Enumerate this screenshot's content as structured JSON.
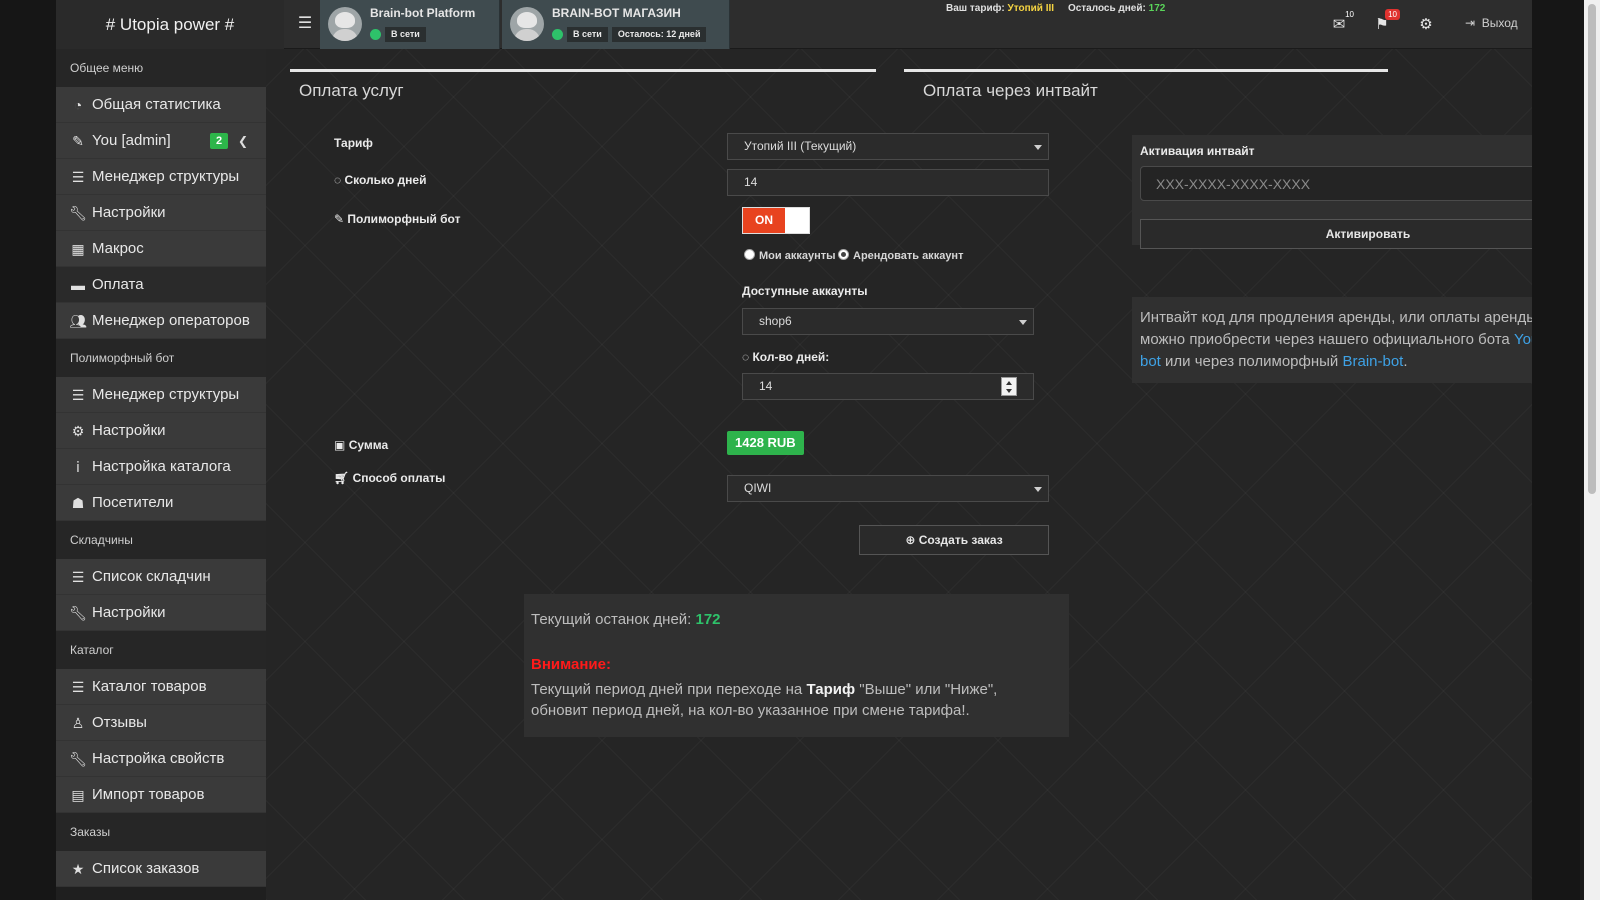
{
  "header": {
    "brand": "# Utopia power #",
    "bots": [
      {
        "name": "Brain-bot Platform",
        "status": "В сети",
        "extra": ""
      },
      {
        "name": "BRAIN-BOT МАГАЗИН",
        "status": "В сети",
        "extra": "Осталось: 12 дней"
      }
    ],
    "tariff_label": "Ваш тариф:",
    "tariff_value": "Утопий III",
    "days_label": "Осталось дней:",
    "days_value": "172",
    "mail_count": "10",
    "flag_count": "10",
    "logout": "Выход"
  },
  "sidebar": {
    "sections": [
      {
        "title": "Общее меню",
        "items": [
          {
            "label": "Общая статистика",
            "icon": "pie-chart-icon"
          },
          {
            "label": "You [admin]",
            "icon": "edit-icon",
            "badge": "2"
          },
          {
            "label": "Менеджер структуры",
            "icon": "list-icon"
          },
          {
            "label": "Настройки",
            "icon": "wrench-icon"
          },
          {
            "label": "Макрос",
            "icon": "grid-icon"
          },
          {
            "label": "Оплата",
            "icon": "credit-card-icon"
          },
          {
            "label": "Менеджер операторов",
            "icon": "users-icon"
          }
        ]
      },
      {
        "title": "Полиморфный бот",
        "items": [
          {
            "label": "Менеджер структуры",
            "icon": "list-icon"
          },
          {
            "label": "Настройки",
            "icon": "gears-icon"
          },
          {
            "label": "Настройка каталога",
            "icon": "info-icon"
          },
          {
            "label": "Посетители",
            "icon": "user-icon"
          }
        ]
      },
      {
        "title": "Складчины",
        "items": [
          {
            "label": "Список складчин",
            "icon": "list-icon"
          },
          {
            "label": "Настройки",
            "icon": "wrench-icon"
          }
        ]
      },
      {
        "title": "Каталог",
        "items": [
          {
            "label": "Каталог товаров",
            "icon": "list-icon"
          },
          {
            "label": "Отзывы",
            "icon": "person-icon"
          },
          {
            "label": "Настройка свойств",
            "icon": "wrench-icon"
          },
          {
            "label": "Импорт товаров",
            "icon": "file-icon"
          }
        ]
      },
      {
        "title": "Заказы",
        "items": [
          {
            "label": "Список заказов",
            "icon": "star-icon"
          }
        ]
      }
    ]
  },
  "payment": {
    "title": "Оплата услуг",
    "tariff_label": "Тариф",
    "tariff_value": "Утопий III (Текущий)",
    "days_label": "Сколько дней",
    "days_value": "14",
    "poly_label": "Полиморфный бот",
    "toggle_label": "ON",
    "radio_my": "Мои аккаунты",
    "radio_rent": "Арендовать аккаунт",
    "accounts_label": "Доступные аккаунты",
    "accounts_value": "shop6",
    "count_days_label": "Кол-во дней:",
    "count_days_value": "14",
    "sum_label": "Сумма",
    "sum_value": "1428 RUB",
    "method_label": "Способ оплаты",
    "method_value": "QIWI",
    "create_button": "Создать заказ"
  },
  "info": {
    "days_text": "Текущий останок дней:",
    "days_value": "172",
    "warning": "Внимание:",
    "text_a": "Текущий период дней при переходе на ",
    "text_bold": "Тариф",
    "text_b": " \"Выше\" или \"Ниже\", обновит период дней, на кол-во указанное при смене тарифа!."
  },
  "invite": {
    "title": "Оплата через интвайт",
    "label": "Активация интвайт",
    "placeholder": "XXX-XXXX-XXXX-XXXX",
    "button": "Активировать",
    "desc_a": "Интвайт код для продления аренды, или оплаты аренды можно приобрести через нашего официального бота ",
    "link1": "You Brain bot",
    "desc_b": " или через полиморфный ",
    "link2": "Brain-bot",
    "desc_c": "."
  },
  "colors": {
    "accent_green": "#2eb34c",
    "toggle_on": "#e8431f",
    "warning_red": "#ff1a1a",
    "link_blue": "#3ea2e6"
  }
}
